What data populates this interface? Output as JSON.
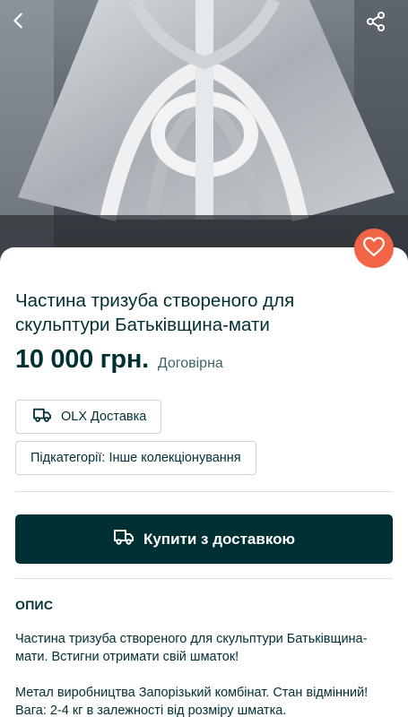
{
  "listing": {
    "title": "Частина тризуба створеного для скульптури Батьківщина-мати",
    "price": "10 000 грн.",
    "price_note": "Договірна"
  },
  "chips": {
    "delivery": "OLX Доставка",
    "subcategory": "Підкатегорії: Інше колекціонування"
  },
  "buy_button": {
    "label": "Купити з доставкою"
  },
  "description": {
    "heading": "ОПИС",
    "paragraph1": "Частина тризуба створеного для скульптури Батьківщина-мати. Встигни отримати свій шматок!",
    "paragraph2_line1": "Метал виробництва Запорізький комбінат. Стан відмінний!",
    "paragraph2_line2": "Вага: 2-4 кг в залежності від розміру шматка."
  },
  "colors": {
    "brand_dark": "#002f34",
    "favorite": "#f26446"
  },
  "icons": {
    "back": "chevron-left-icon",
    "share": "share-icon",
    "favorite": "heart-icon",
    "delivery": "truck-icon"
  }
}
